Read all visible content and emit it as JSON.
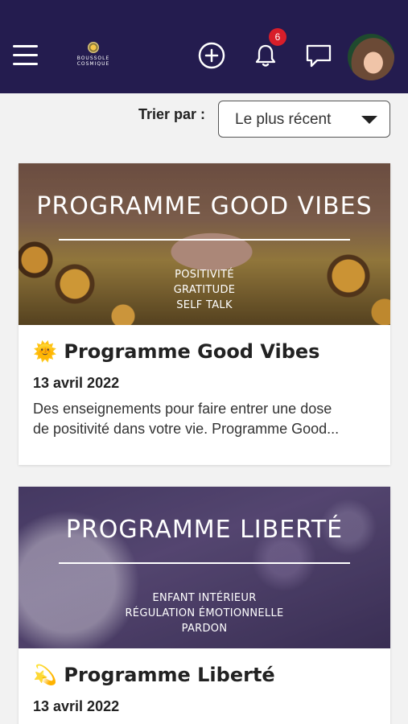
{
  "header": {
    "logo_text_line1": "BOUSSOLE",
    "logo_text_line2": "COSMIQUE",
    "notification_count": "6",
    "icons": [
      "menu-icon",
      "plus-circle-icon",
      "bell-icon",
      "chat-bubble-icon"
    ],
    "colors": {
      "bar": "#241c4f",
      "badge": "#d81e2a"
    }
  },
  "sort": {
    "label": "Trier par :",
    "selected": "Le plus récent"
  },
  "cards": [
    {
      "banner_title": "PROGRAMME GOOD VIBES",
      "banner_tags": [
        "POSITIVITÉ",
        "GRATITUDE",
        "SELF TALK"
      ],
      "emoji": "🌞",
      "title": "Programme Good Vibes",
      "date": "13 avril 2022",
      "description_line1": "Des enseignements pour faire entrer une dose",
      "description_line2": "de positivité dans votre vie. Programme Good..."
    },
    {
      "banner_title": "PROGRAMME LIBERTÉ",
      "banner_tags": [
        "ENFANT INTÉRIEUR",
        "RÉGULATION ÉMOTIONNELLE",
        "PARDON"
      ],
      "emoji": "💫",
      "title": "Programme Liberté",
      "date": "13 avril 2022"
    }
  ]
}
